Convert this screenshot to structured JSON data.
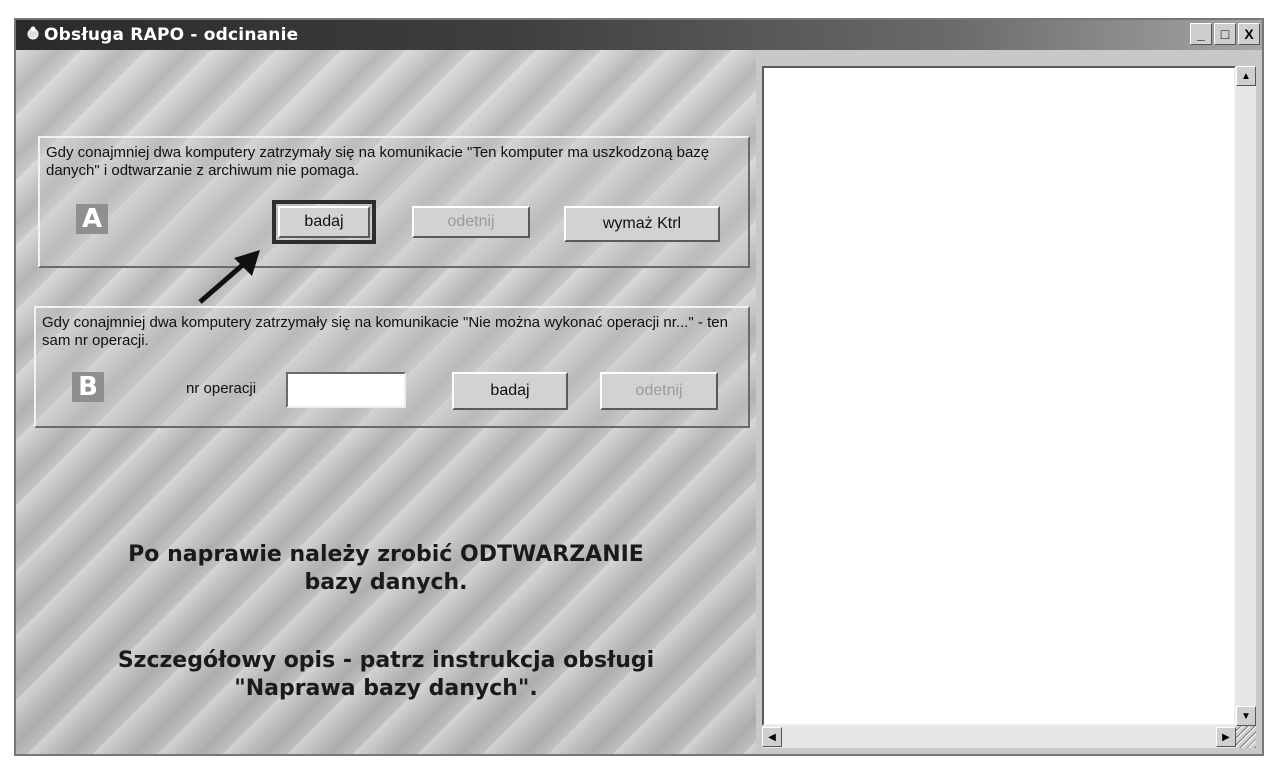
{
  "window": {
    "title": "Obsługa RAPO - odcinanie",
    "controls": {
      "minimize": "_",
      "maximize": "□",
      "close": "X"
    }
  },
  "section_a": {
    "letter": "A",
    "description": "Gdy conajmniej dwa komputery zatrzymały się na komunikacie \"Ten komputer ma uszkodzoną bazę danych\" i odtwarzanie z archiwum nie pomaga.",
    "buttons": {
      "badaj": "badaj",
      "odetnij": "odetnij",
      "wymaz": "wymaż Ktrl"
    }
  },
  "section_b": {
    "letter": "B",
    "description": "Gdy conajmniej dwa komputery zatrzymały się na komunikacie \"Nie można wykonać operacji nr...\" - ten sam nr operacji.",
    "operation_label": "nr operacji",
    "operation_value": "",
    "buttons": {
      "badaj": "badaj",
      "odetnij": "odetnij"
    }
  },
  "notes": {
    "line1": "Po naprawie należy zrobić ODTWARZANIE",
    "line2": "bazy danych.",
    "line3": "Szczegółowy opis - patrz instrukcja obsługi",
    "line4": "\"Naprawa bazy danych\"."
  },
  "log_panel": {
    "content": ""
  },
  "icons": {
    "title": "app-icon",
    "arrow": "pointer-arrow-icon",
    "scroll_up": "▲",
    "scroll_down": "▼",
    "scroll_left": "◀",
    "scroll_right": "▶"
  }
}
